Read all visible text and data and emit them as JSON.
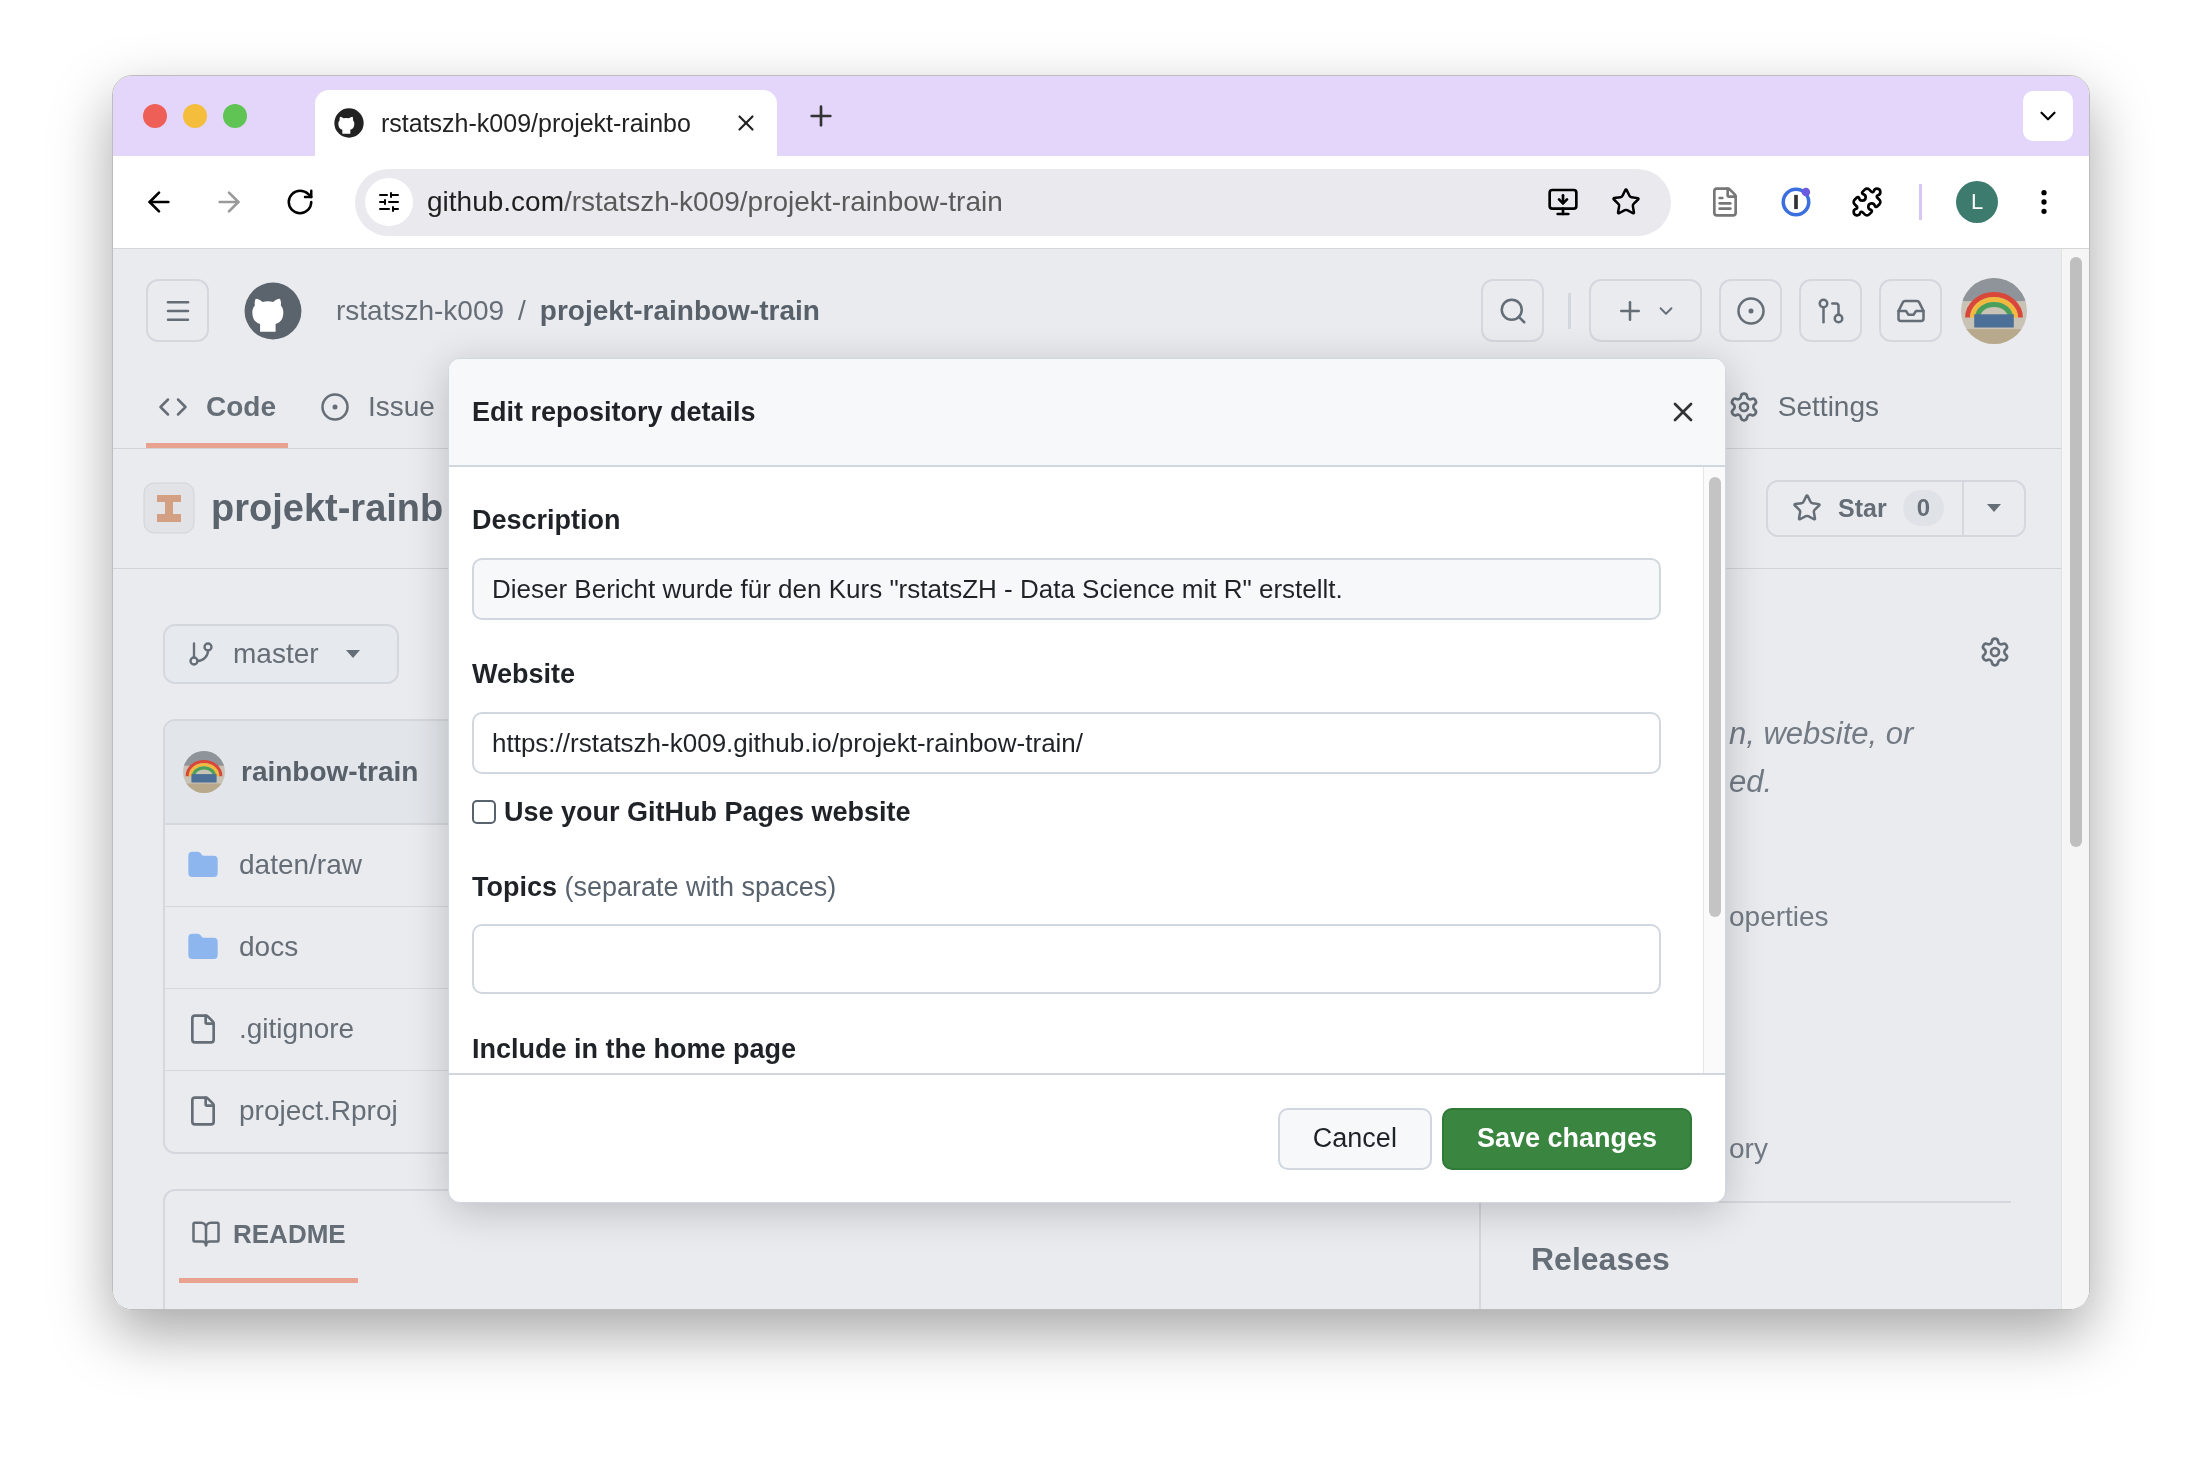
{
  "browser": {
    "tab": {
      "title": "rstatszh-k009/projekt-rainbo",
      "selected": true
    },
    "url": {
      "host": "github.com",
      "path": "/rstatszh-k009/projekt-rainbow-train"
    },
    "profile": "L"
  },
  "header": {
    "owner": "rstatszh-k009",
    "separator": "/",
    "repo": "projekt-rainbow-train"
  },
  "nav_tabs": [
    {
      "label": "Code",
      "kind": "code",
      "selected": true
    },
    {
      "label": "Issue",
      "kind": "issue",
      "selected": false
    }
  ],
  "settings_tab": {
    "label": "Settings",
    "selected": false
  },
  "repo": {
    "title": "projekt-rainb",
    "star": {
      "label": "Star",
      "count": "0"
    }
  },
  "branch": {
    "label": "master"
  },
  "files": {
    "commit_author": "rainbow-train",
    "items": [
      {
        "name": "daten/raw",
        "kind": "folder"
      },
      {
        "name": "docs",
        "kind": "folder"
      },
      {
        "name": ".gitignore",
        "kind": "file"
      },
      {
        "name": "project.Rproj",
        "kind": "file"
      }
    ]
  },
  "about": {
    "fragments": [
      {
        "text": "n, website, or",
        "kind": "italic"
      },
      {
        "text": "ed.",
        "kind": "italic"
      },
      {
        "text": "operties",
        "kind": "link"
      },
      {
        "text": "ory",
        "kind": "link"
      }
    ]
  },
  "readme": {
    "label": "README",
    "selected": true
  },
  "releases": {
    "title": "Releases"
  },
  "dialog": {
    "title": "Edit repository details",
    "description": {
      "label": "Description",
      "value": "Dieser Bericht wurde für den Kurs \"rstatsZH - Data Science mit R\" erstellt."
    },
    "website": {
      "label": "Website",
      "value": "https://rstatszh-k009.github.io/projekt-rainbow-train/"
    },
    "pages_checkbox": {
      "label": "Use your GitHub Pages website",
      "checked": false
    },
    "topics": {
      "label": "Topics",
      "hint": "(separate with spaces)"
    },
    "section": "Include in the home page",
    "buttons": [
      {
        "label": "Cancel",
        "kind": "secondary"
      },
      {
        "label": "Save changes",
        "kind": "primary"
      }
    ]
  }
}
